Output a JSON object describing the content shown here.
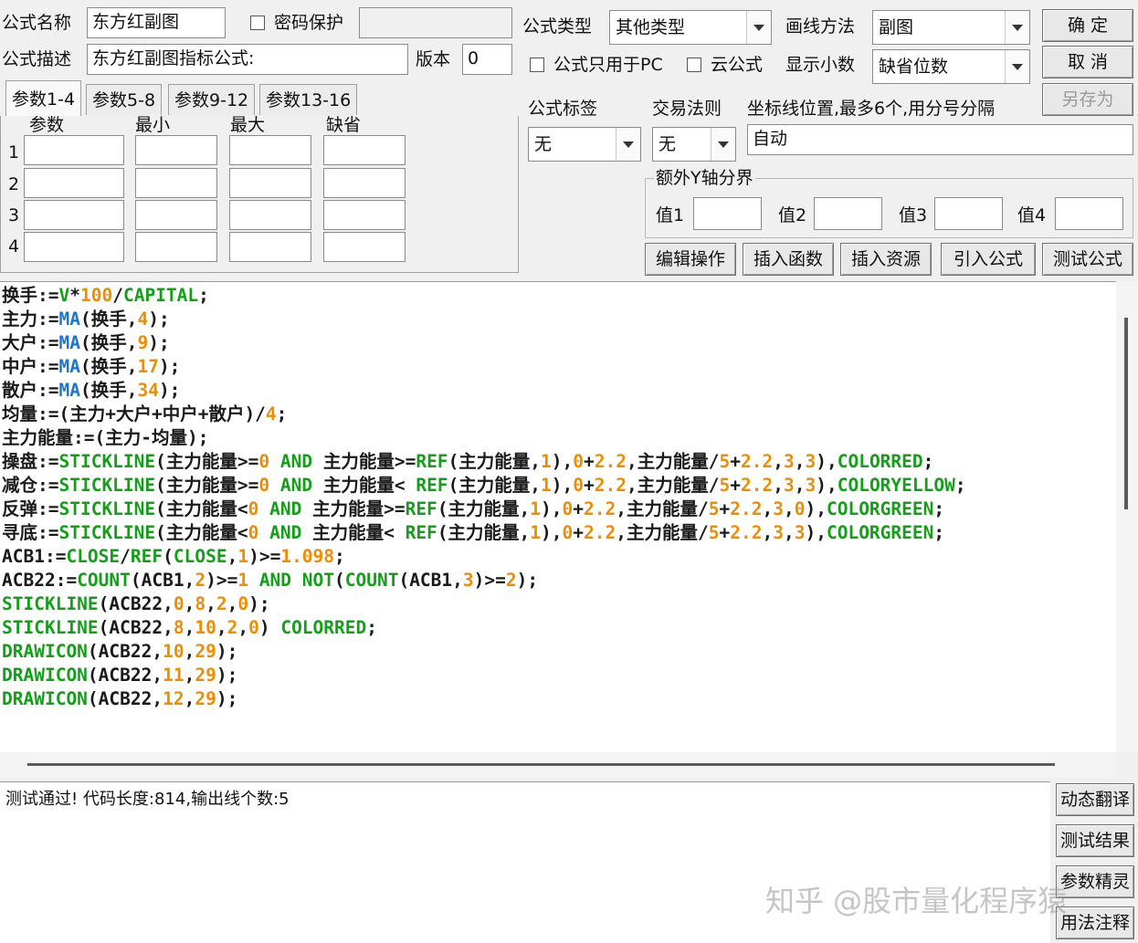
{
  "colors": {
    "green": "#13a018",
    "orange": "#f08c00",
    "blue": "#1976d2",
    "dark": "#1a1a1a"
  },
  "header": {
    "name_label": "公式名称",
    "name_value": "东方红副图",
    "password_label": "密码保护",
    "desc_label": "公式描述",
    "desc_value": "东方红副图指标公式:",
    "version_label": "版本",
    "version_value": "0",
    "type_label": "公式类型",
    "type_value": "其他类型",
    "draw_label": "画线方法",
    "draw_value": "副图",
    "pc_only_label": "公式只用于PC",
    "cloud_label": "云公式",
    "decimal_label": "显示小数",
    "decimal_value": "缺省位数",
    "ok_label": "确  定",
    "cancel_label": "取  消",
    "saveas_label": "另存为"
  },
  "tabs": [
    "参数1-4",
    "参数5-8",
    "参数9-12",
    "参数13-16"
  ],
  "params": {
    "headers": [
      "参数",
      "最小",
      "最大",
      "缺省"
    ],
    "rows": [
      "1",
      "2",
      "3",
      "4"
    ]
  },
  "tag": {
    "label": "公式标签",
    "value": "无"
  },
  "trade": {
    "label": "交易法则",
    "value": "无"
  },
  "axis": {
    "label": "坐标线位置,最多6个,用分号分隔",
    "value": "自动"
  },
  "extra_y": {
    "label": "额外Y轴分界",
    "v1": "值1",
    "v2": "值2",
    "v3": "值3",
    "v4": "值4"
  },
  "actions": [
    "编辑操作",
    "插入函数",
    "插入资源",
    "引入公式",
    "测试公式"
  ],
  "code_lines": [
    [
      [
        "dark",
        "换手:="
      ],
      [
        "green",
        "V"
      ],
      [
        "dark",
        "*"
      ],
      [
        "orange",
        "100"
      ],
      [
        "dark",
        "/"
      ],
      [
        "green",
        "CAPITAL"
      ],
      [
        "dark",
        ";"
      ]
    ],
    [
      [
        "dark",
        "主力:="
      ],
      [
        "blue",
        "MA"
      ],
      [
        "dark",
        "(换手,"
      ],
      [
        "orange",
        "4"
      ],
      [
        "dark",
        ");"
      ]
    ],
    [
      [
        "dark",
        "大户:="
      ],
      [
        "blue",
        "MA"
      ],
      [
        "dark",
        "(换手,"
      ],
      [
        "orange",
        "9"
      ],
      [
        "dark",
        ");"
      ]
    ],
    [
      [
        "dark",
        "中户:="
      ],
      [
        "blue",
        "MA"
      ],
      [
        "dark",
        "(换手,"
      ],
      [
        "orange",
        "17"
      ],
      [
        "dark",
        ");"
      ]
    ],
    [
      [
        "dark",
        "散户:="
      ],
      [
        "blue",
        "MA"
      ],
      [
        "dark",
        "(换手,"
      ],
      [
        "orange",
        "34"
      ],
      [
        "dark",
        ");"
      ]
    ],
    [
      [
        "dark",
        "均量:=(主力+大户+中户+散户)/"
      ],
      [
        "orange",
        "4"
      ],
      [
        "dark",
        ";"
      ]
    ],
    [
      [
        "dark",
        "主力能量:=(主力-均量);"
      ]
    ],
    [
      [
        "dark",
        "操盘:="
      ],
      [
        "green",
        "STICKLINE"
      ],
      [
        "dark",
        "(主力能量>="
      ],
      [
        "orange",
        "0"
      ],
      [
        "green",
        " AND "
      ],
      [
        "dark",
        "主力能量>="
      ],
      [
        "green",
        "REF"
      ],
      [
        "dark",
        "(主力能量,"
      ],
      [
        "orange",
        "1"
      ],
      [
        "dark",
        "),"
      ],
      [
        "orange",
        "0"
      ],
      [
        "dark",
        "+"
      ],
      [
        "orange",
        "2.2"
      ],
      [
        "dark",
        ",主力能量/"
      ],
      [
        "orange",
        "5"
      ],
      [
        "dark",
        "+"
      ],
      [
        "orange",
        "2.2"
      ],
      [
        "dark",
        ","
      ],
      [
        "orange",
        "3"
      ],
      [
        "dark",
        ","
      ],
      [
        "orange",
        "3"
      ],
      [
        "dark",
        "),"
      ],
      [
        "green",
        "COLORRED"
      ],
      [
        "dark",
        ";"
      ]
    ],
    [
      [
        "dark",
        "减仓:="
      ],
      [
        "green",
        "STICKLINE"
      ],
      [
        "dark",
        "(主力能量>="
      ],
      [
        "orange",
        "0"
      ],
      [
        "green",
        " AND "
      ],
      [
        "dark",
        "主力能量< "
      ],
      [
        "green",
        "REF"
      ],
      [
        "dark",
        "(主力能量,"
      ],
      [
        "orange",
        "1"
      ],
      [
        "dark",
        "),"
      ],
      [
        "orange",
        "0"
      ],
      [
        "dark",
        "+"
      ],
      [
        "orange",
        "2.2"
      ],
      [
        "dark",
        ",主力能量/"
      ],
      [
        "orange",
        "5"
      ],
      [
        "dark",
        "+"
      ],
      [
        "orange",
        "2.2"
      ],
      [
        "dark",
        ","
      ],
      [
        "orange",
        "3"
      ],
      [
        "dark",
        ","
      ],
      [
        "orange",
        "3"
      ],
      [
        "dark",
        "),"
      ],
      [
        "green",
        "COLORYELLOW"
      ],
      [
        "dark",
        ";"
      ]
    ],
    [
      [
        "dark",
        "反弹:="
      ],
      [
        "green",
        "STICKLINE"
      ],
      [
        "dark",
        "(主力能量<"
      ],
      [
        "orange",
        "0"
      ],
      [
        "green",
        " AND "
      ],
      [
        "dark",
        "主力能量>="
      ],
      [
        "green",
        "REF"
      ],
      [
        "dark",
        "(主力能量,"
      ],
      [
        "orange",
        "1"
      ],
      [
        "dark",
        "),"
      ],
      [
        "orange",
        "0"
      ],
      [
        "dark",
        "+"
      ],
      [
        "orange",
        "2.2"
      ],
      [
        "dark",
        ",主力能量/"
      ],
      [
        "orange",
        "5"
      ],
      [
        "dark",
        "+"
      ],
      [
        "orange",
        "2.2"
      ],
      [
        "dark",
        ","
      ],
      [
        "orange",
        "3"
      ],
      [
        "dark",
        ","
      ],
      [
        "orange",
        "0"
      ],
      [
        "dark",
        "),"
      ],
      [
        "green",
        "COLORGREEN"
      ],
      [
        "dark",
        ";"
      ]
    ],
    [
      [
        "dark",
        "寻底:="
      ],
      [
        "green",
        "STICKLINE"
      ],
      [
        "dark",
        "(主力能量<"
      ],
      [
        "orange",
        "0"
      ],
      [
        "green",
        " AND "
      ],
      [
        "dark",
        "主力能量< "
      ],
      [
        "green",
        "REF"
      ],
      [
        "dark",
        "(主力能量,"
      ],
      [
        "orange",
        "1"
      ],
      [
        "dark",
        "),"
      ],
      [
        "orange",
        "0"
      ],
      [
        "dark",
        "+"
      ],
      [
        "orange",
        "2.2"
      ],
      [
        "dark",
        ",主力能量/"
      ],
      [
        "orange",
        "5"
      ],
      [
        "dark",
        "+"
      ],
      [
        "orange",
        "2.2"
      ],
      [
        "dark",
        ","
      ],
      [
        "orange",
        "3"
      ],
      [
        "dark",
        ","
      ],
      [
        "orange",
        "3"
      ],
      [
        "dark",
        "),"
      ],
      [
        "green",
        "COLORGREEN"
      ],
      [
        "dark",
        ";"
      ]
    ],
    [
      [
        "dark",
        "ACB1:="
      ],
      [
        "green",
        "CLOSE"
      ],
      [
        "dark",
        "/"
      ],
      [
        "green",
        "REF"
      ],
      [
        "dark",
        "("
      ],
      [
        "green",
        "CLOSE"
      ],
      [
        "dark",
        ","
      ],
      [
        "orange",
        "1"
      ],
      [
        "dark",
        ")>="
      ],
      [
        "orange",
        "1.098"
      ],
      [
        "dark",
        ";"
      ]
    ],
    [
      [
        "dark",
        "ACB22:="
      ],
      [
        "green",
        "COUNT"
      ],
      [
        "dark",
        "(ACB1,"
      ],
      [
        "orange",
        "2"
      ],
      [
        "dark",
        ")>="
      ],
      [
        "orange",
        "1"
      ],
      [
        "green",
        " AND NOT"
      ],
      [
        "dark",
        "("
      ],
      [
        "green",
        "COUNT"
      ],
      [
        "dark",
        "(ACB1,"
      ],
      [
        "orange",
        "3"
      ],
      [
        "dark",
        ")>="
      ],
      [
        "orange",
        "2"
      ],
      [
        "dark",
        ");"
      ]
    ],
    [
      [
        "green",
        "STICKLINE"
      ],
      [
        "dark",
        "(ACB22,"
      ],
      [
        "orange",
        "0"
      ],
      [
        "dark",
        ","
      ],
      [
        "orange",
        "8"
      ],
      [
        "dark",
        ","
      ],
      [
        "orange",
        "2"
      ],
      [
        "dark",
        ","
      ],
      [
        "orange",
        "0"
      ],
      [
        "dark",
        ");"
      ]
    ],
    [
      [
        "green",
        "STICKLINE"
      ],
      [
        "dark",
        "(ACB22,"
      ],
      [
        "orange",
        "8"
      ],
      [
        "dark",
        ","
      ],
      [
        "orange",
        "10"
      ],
      [
        "dark",
        ","
      ],
      [
        "orange",
        "2"
      ],
      [
        "dark",
        ","
      ],
      [
        "orange",
        "0"
      ],
      [
        "dark",
        ") "
      ],
      [
        "green",
        "COLORRED"
      ],
      [
        "dark",
        ";"
      ]
    ],
    [
      [
        "green",
        "DRAWICON"
      ],
      [
        "dark",
        "(ACB22,"
      ],
      [
        "orange",
        "10"
      ],
      [
        "dark",
        ","
      ],
      [
        "orange",
        "29"
      ],
      [
        "dark",
        ");"
      ]
    ],
    [
      [
        "green",
        "DRAWICON"
      ],
      [
        "dark",
        "(ACB22,"
      ],
      [
        "orange",
        "11"
      ],
      [
        "dark",
        ","
      ],
      [
        "orange",
        "29"
      ],
      [
        "dark",
        ");"
      ]
    ],
    [
      [
        "green",
        "DRAWICON"
      ],
      [
        "dark",
        "(ACB22,"
      ],
      [
        "orange",
        "12"
      ],
      [
        "dark",
        ","
      ],
      [
        "orange",
        "29"
      ],
      [
        "dark",
        ");"
      ]
    ]
  ],
  "result": {
    "text": "测试通过! 代码长度:814,输出线个数:5"
  },
  "side_buttons": [
    "动态翻译",
    "测试结果",
    "参数精灵",
    "用法注释"
  ],
  "watermark": "知乎 @股市量化程序猿"
}
